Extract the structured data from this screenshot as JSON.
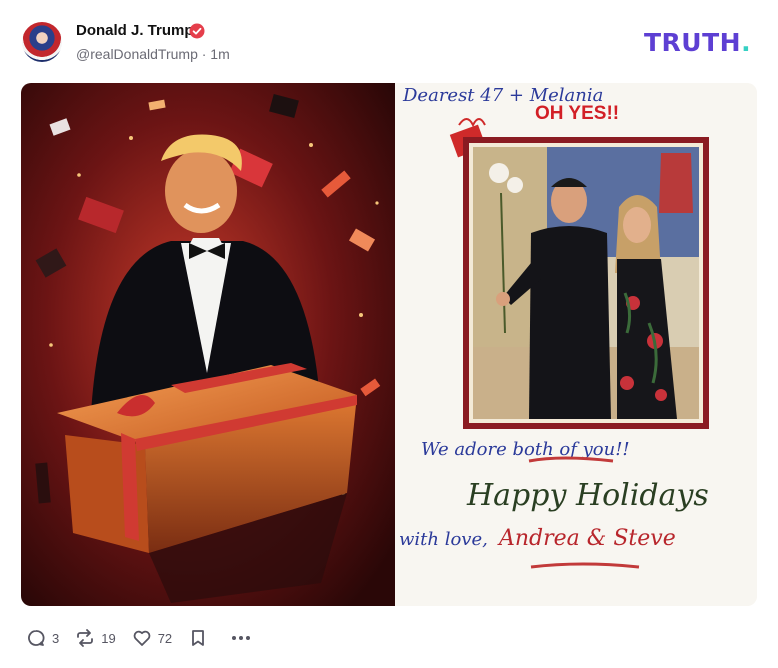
{
  "post": {
    "author_name": "Donald J. Trump",
    "author_handle": "@realDonaldTrump",
    "time": "1m",
    "handle_line": "@realDonaldTrump · 1m"
  },
  "brand": {
    "text": "TRUTH",
    "dot": "."
  },
  "image": {
    "card_heading": "Dearest 47 + Melania",
    "card_exclaim": "OH YES!!",
    "card_adore": "We adore both of you!!",
    "card_holidays": "Happy Holidays",
    "card_withlove": "with love,",
    "card_names": "Andrea & Steve"
  },
  "actions": {
    "replies": "3",
    "retruths": "19",
    "likes": "72"
  },
  "icons": [
    "verified-badge-icon",
    "reply-icon",
    "retruth-icon",
    "like-icon",
    "bookmark-icon",
    "more-icon"
  ],
  "colors": {
    "brand_purple": "#5d3fd3",
    "brand_teal": "#35d0c3",
    "verified": "#e53e4b",
    "action_gray": "#565662"
  }
}
